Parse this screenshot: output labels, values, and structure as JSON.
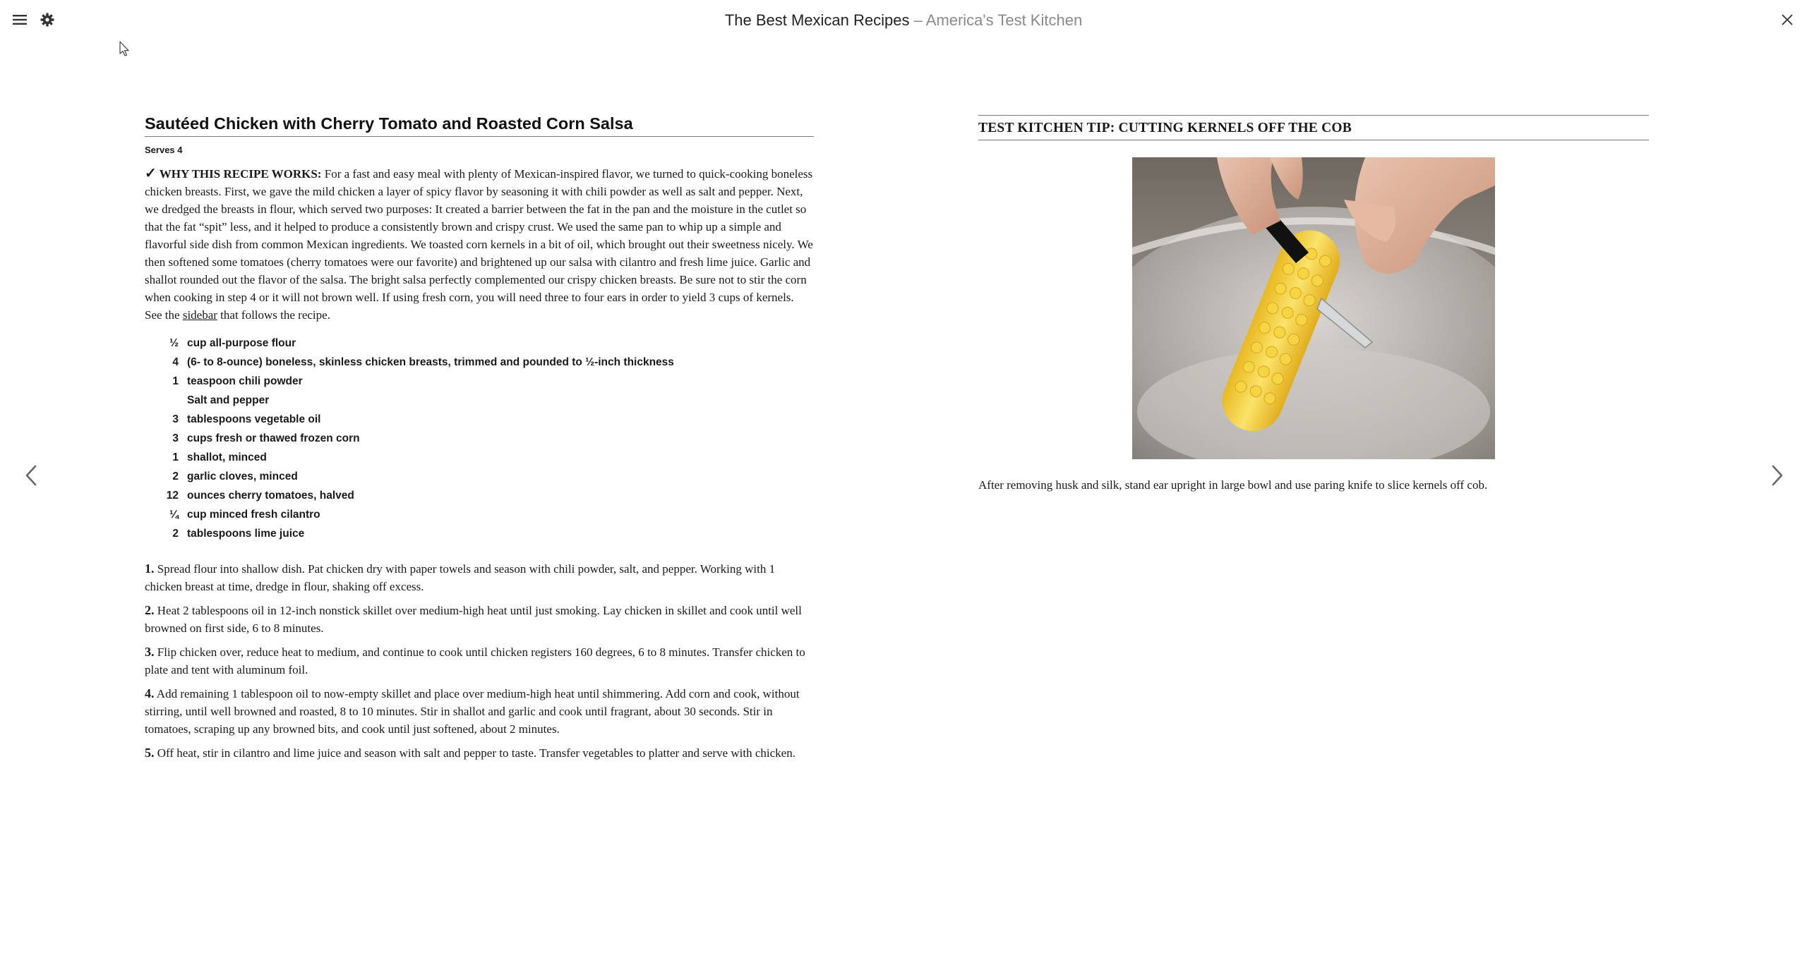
{
  "header": {
    "book_title": "The Best Mexican Recipes",
    "separator": " – ",
    "publisher": "America's Test Kitchen"
  },
  "icons": {
    "menu": "hamburger-menu-icon",
    "settings": "gear-icon",
    "close": "close-icon",
    "prev": "chevron-left-icon",
    "next": "chevron-right-icon"
  },
  "recipe": {
    "title": "Sautéed Chicken with Cherry Tomato and Roasted Corn Salsa",
    "serves": "Serves 4",
    "why_mark": "✓",
    "why_label": "WHY THIS RECIPE WORKS:",
    "why_text": " For a fast and easy meal with plenty of Mexican-inspired flavor, we turned to quick-cooking boneless chicken breasts. First, we gave the mild chicken a layer of spicy flavor by seasoning it with chili powder as well as salt and pepper. Next, we dredged the breasts in flour, which served two purposes: It created a barrier between the fat in the pan and the moisture in the cutlet so that the fat “spit” less, and it helped to produce a consistently brown and crispy crust. We used the same pan to whip up a simple and flavorful side dish from common Mexican ingredients. We toasted corn kernels in a bit of oil, which brought out their sweetness nicely. We then softened some tomatoes (cherry tomatoes were our favorite) and brightened up our salsa with cilantro and fresh lime juice. Garlic and shallot rounded out the flavor of the salsa. The bright salsa perfectly complemented our crispy chicken breasts. Be sure not to stir the corn when cooking in step 4 or it will not brown well. If using fresh corn, you will need three to four ears in order to yield 3 cups of kernels. See the ",
    "why_link": "sidebar",
    "why_tail": " that follows the recipe.",
    "ingredients": [
      {
        "qty": "½",
        "text": "cup all-purpose flour"
      },
      {
        "qty": "4",
        "text": "(6- to 8-ounce) boneless, skinless chicken breasts, trimmed and pounded to ½-inch thickness"
      },
      {
        "qty": "1",
        "text": "teaspoon chili powder"
      },
      {
        "qty": "",
        "text": "Salt and pepper"
      },
      {
        "qty": "3",
        "text": "tablespoons vegetable oil"
      },
      {
        "qty": "3",
        "text": "cups fresh or thawed frozen corn"
      },
      {
        "qty": "1",
        "text": "shallot, minced"
      },
      {
        "qty": "2",
        "text": "garlic cloves, minced"
      },
      {
        "qty": "12",
        "text": "ounces cherry tomatoes, halved"
      },
      {
        "qty": "¼",
        "text": "cup minced fresh cilantro"
      },
      {
        "qty": "2",
        "text": "tablespoons lime juice"
      }
    ],
    "steps": [
      {
        "num": "1.",
        "text": " Spread flour into shallow dish. Pat chicken dry with paper towels and season with chili powder, salt, and pepper. Working with 1 chicken breast at time, dredge in flour, shaking off excess."
      },
      {
        "num": "2.",
        "text": " Heat 2 tablespoons oil in 12-inch nonstick skillet over medium-high heat until just smoking. Lay chicken in skillet and cook until well browned on first side, 6 to 8 minutes."
      },
      {
        "num": "3.",
        "text": " Flip chicken over, reduce heat to medium, and continue to cook until chicken registers 160 degrees, 6 to 8 minutes. Transfer chicken to plate and tent with aluminum foil."
      },
      {
        "num": "4.",
        "text": " Add remaining 1 tablespoon oil to now-empty skillet and place over medium-high heat until shimmering. Add corn and cook, without stirring, until well browned and roasted, 8 to 10 minutes. Stir in shallot and garlic and cook until fragrant, about 30 seconds. Stir in tomatoes, scraping up any browned bits, and cook until just softened, about 2 minutes."
      },
      {
        "num": "5.",
        "text": " Off heat, stir in cilantro and lime juice and season with salt and pepper to taste. Transfer vegetables to platter and serve with chicken."
      }
    ]
  },
  "tip": {
    "title": "TEST KITCHEN TIP: CUTTING KERNELS OFF THE COB",
    "caption": "After removing husk and silk, stand ear upright in large bowl and use paring knife to slice kernels off cob."
  },
  "colors": {
    "text": "#1a1a1a",
    "muted_title": "#8a8a8a",
    "rule": "#777777",
    "corn": "#f2cf3a"
  }
}
